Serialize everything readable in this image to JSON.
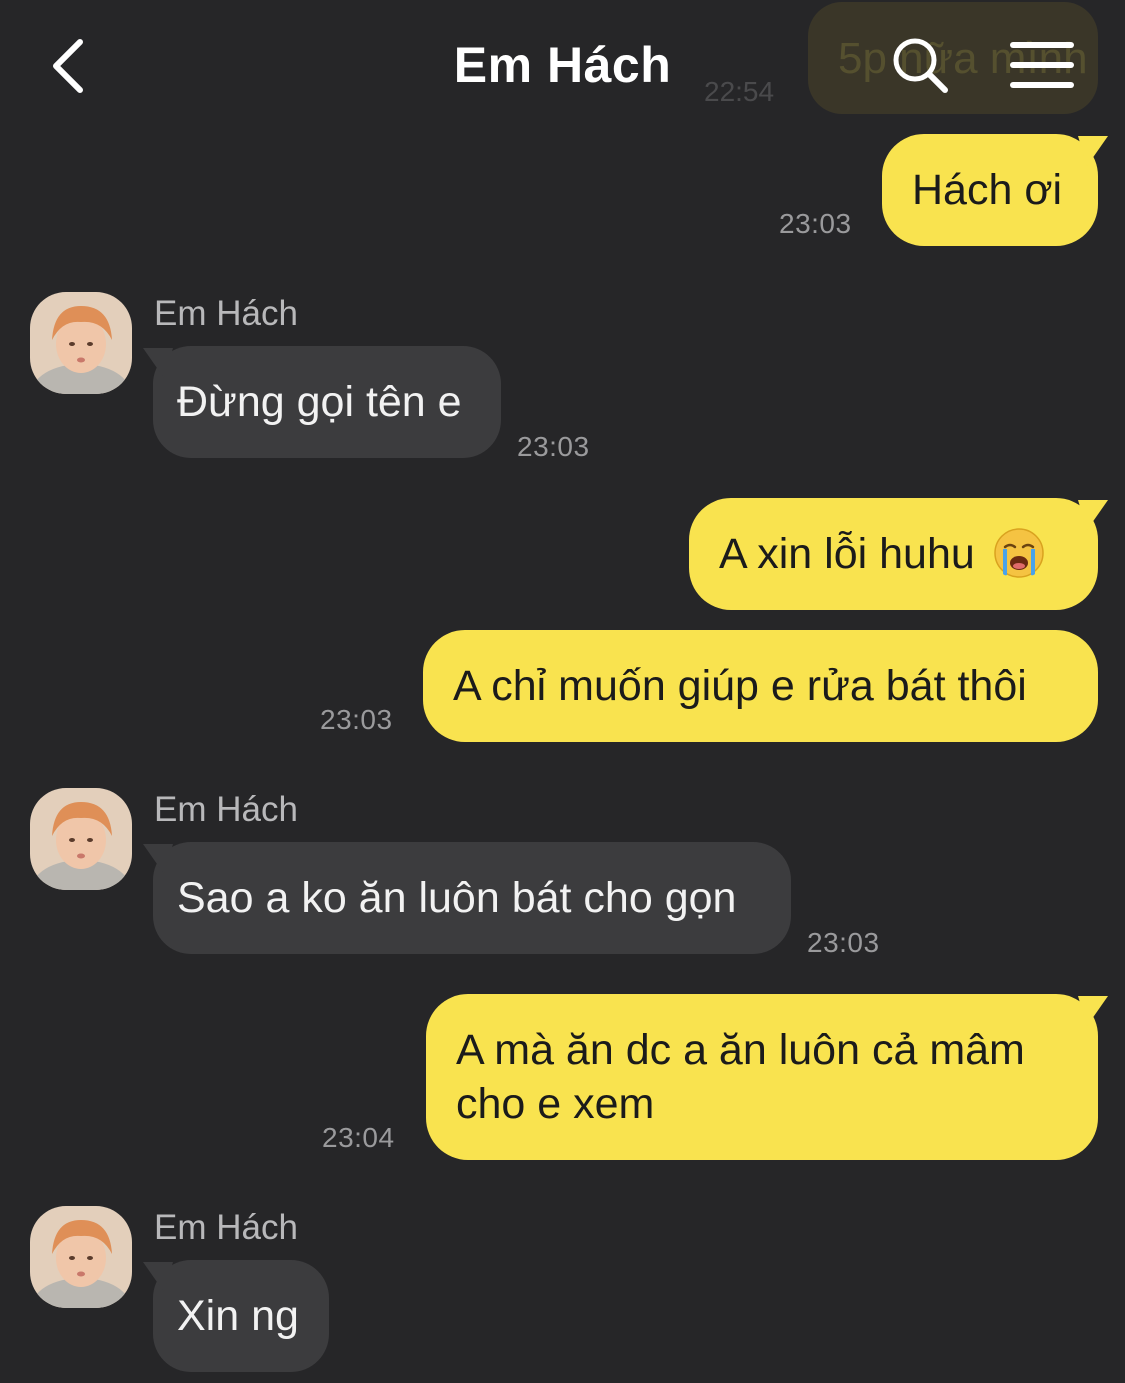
{
  "header": {
    "title": "Em Hách",
    "back_label": "back",
    "search_label": "search",
    "menu_label": "menu"
  },
  "ghost_message": {
    "text": "5p nữa mình",
    "time": "22:54"
  },
  "messages": [
    {
      "from": "me",
      "text": "Hách ơi",
      "time": "23:03"
    },
    {
      "from": "them",
      "sender": "Em Hách",
      "text": "Đừng gọi tên e",
      "time": "23:03"
    },
    {
      "from": "me",
      "text": "A xin lỗi huhu",
      "emoji": "loudly-crying-face-icon"
    },
    {
      "from": "me",
      "text": "A chỉ muốn giúp e rửa bát thôi",
      "time": "23:03"
    },
    {
      "from": "them",
      "sender": "Em Hách",
      "text": "Sao a ko ăn luôn bát cho gọn",
      "time": "23:03"
    },
    {
      "from": "me",
      "lines": [
        "A mà ăn dc a ăn luôn cả mâm",
        "cho e xem"
      ],
      "time": "23:04"
    },
    {
      "from": "them",
      "sender": "Em Hách",
      "text": "Xin ng"
    }
  ],
  "colors": {
    "background": "#262628",
    "my_bubble": "#f9e34f",
    "their_bubble": "#3c3c3e",
    "timestamp": "#9a9a9c"
  }
}
